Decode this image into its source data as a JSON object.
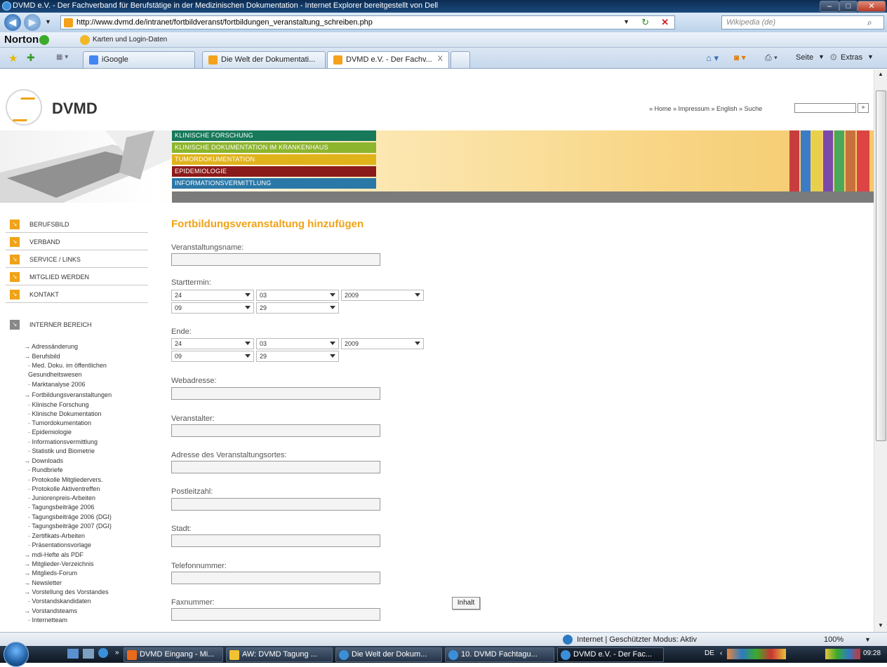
{
  "window": {
    "title": "DVMD e.V. - Der Fachverband für Berufstätige in der Medizinischen Dokumentation - Internet Explorer bereitgestellt von Dell"
  },
  "address": {
    "url": "http://www.dvmd.de/intranet/fortbildveranst/fortbildungen_veranstaltung_schreiben.php",
    "search_placeholder": "Wikipedia (de)"
  },
  "norton": {
    "brand": "Norton",
    "karten_label": "Karten und Login-Daten"
  },
  "tabs": {
    "igoogle": "iGoogle",
    "tab1": "Die Welt der Dokumentati...",
    "tab2": "DVMD e.V. - Der Fachv...",
    "close": "X"
  },
  "commandbar": {
    "seite": "Seite",
    "extras": "Extras"
  },
  "site": {
    "logo_text": "DVMD",
    "toplinks": "» Home  » Impressum  » English  » Suche",
    "categories": [
      "KLINISCHE FORSCHUNG",
      "KLINISCHE DOKUMENTATION IM KRANKENHAUS",
      "TUMORDOKUMENTATION",
      "EPIDEMIOLOGIE",
      "INFORMATIONSVERMITTLUNG"
    ],
    "colors": {
      "accent": "#f0a318",
      "cat1": "#17795a",
      "cat2": "#8db52e",
      "cat3": "#e0b31b",
      "cat4": "#8b1a1a",
      "cat5": "#2a78a8"
    }
  },
  "nav": {
    "main": [
      "BERUFSBILD",
      "VERBAND",
      "SERVICE / LINKS",
      "MITGLIED WERDEN",
      "KONTAKT"
    ],
    "internal": "INTERNER BEREICH"
  },
  "subnav": [
    "→ Adressänderung",
    "→ Berufsbild",
    "· Med. Doku. im öffentlichen",
    "Gesundheitswesen",
    "· Marktanalyse 2006",
    "→ Fortbildungsveranstaltungen",
    "· Klinische Forschung",
    "· Klinische Dokumentation",
    "· Tumordokumentation",
    "· Epidemiologie",
    "· Informationsvermittlung",
    "· Statistik und Biometrie",
    "→ Downloads",
    "· Rundbriefe",
    "· Protokolle Mitgliedervers.",
    "· Protokolle Aktiventreffen",
    "· Juniorenpreis-Arbeiten",
    "· Tagungsbeiträge 2006",
    "· Tagungsbeiträge 2006 (DGI)",
    "· Tagungsbeiträge 2007 (DGI)",
    "· Zertifikats-Arbeiten",
    "· Präsentationsvorlage",
    "→ mdi-Hefte als PDF",
    "→ Mitglieder-Verzeichnis",
    "→ Mitglieds-Forum",
    "→ Newsletter",
    "→ Vorstellung des Vorstandes",
    "· Vorstandskandidaten",
    "→ Vorstandsteams",
    "· Internetteam"
  ],
  "form": {
    "title": "Fortbildungsveranstaltung hinzufügen",
    "labels": {
      "name": "Veranstaltungsname:",
      "start": "Starttermin:",
      "end": "Ende:",
      "web": "Webadresse:",
      "org": "Veranstalter:",
      "addr": "Adresse des Veranstaltungsortes:",
      "plz": "Postleitzahl:",
      "city": "Stadt:",
      "tel": "Telefonnummer:",
      "fax": "Faxnummer:"
    },
    "start": {
      "day": "24",
      "month": "03",
      "year": "2009",
      "hour": "09",
      "minute": "29"
    },
    "end": {
      "day": "24",
      "month": "03",
      "year": "2009",
      "hour": "09",
      "minute": "29"
    },
    "inhalt_button": "Inhalt"
  },
  "status": {
    "zone": "Internet | Geschützter Modus: Aktiv",
    "zoom": "100%"
  },
  "taskbar": {
    "items": [
      "DVMD Eingang - Mi...",
      "AW: DVMD Tagung ...",
      "Die Welt der Dokum...",
      "10. DVMD Fachtagu...",
      "DVMD e.V. - Der Fac..."
    ],
    "lang": "DE",
    "time": "09:28"
  }
}
